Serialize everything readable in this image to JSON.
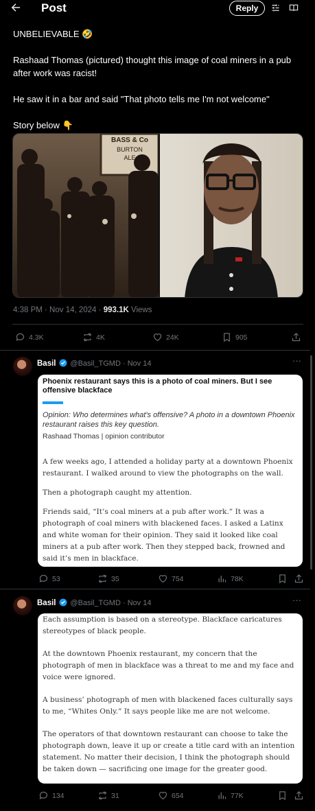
{
  "header": {
    "title": "Post",
    "reply_label": "Reply"
  },
  "main_tweet": {
    "text": "UNBELIEVABLE 🤣\n\nRashaad Thomas (pictured) thought this image of coal miners in a pub after work was racist!\n\nHe saw it in a bar and said \"That photo tells me I'm not welcome\"\n\nStory below 👇",
    "photo_sign_1": "BASS & Co",
    "photo_sign_2": "BURTON",
    "photo_sign_3": "ALE",
    "time": "4:38 PM · Nov 14, 2024 · ",
    "views_count": "993.1K",
    "views_label": " Views",
    "stats": {
      "replies": "4.3K",
      "reposts": "4K",
      "likes": "24K",
      "bookmarks": "905"
    }
  },
  "reply1": {
    "name": "Basil",
    "handle": "@Basil_TGMD · Nov 14",
    "headline": "Phoenix restaurant says this is a photo of coal miners. But I see offensive blackface",
    "subhead": "Opinion: Who determines what's offensive? A photo in a downtown Phoenix restaurant raises this key question.",
    "byline": "Rashaad Thomas  |  opinion contributor",
    "paragraphs": [
      "A few weeks ago, I attended a holiday party at a downtown Phoenix restaurant. I walked around to view the photographs on the wall.",
      "Then a photograph caught my attention.",
      "Friends said, “It’s coal miners at a pub after work.” It was a photograph of coal miners with blackened faces. I asked a Latinx and white woman for their opinion. They said it looked like coal miners at a pub after work. Then they stepped back, frowned and said it’s men in blackface."
    ],
    "stats": {
      "replies": "53",
      "reposts": "35",
      "likes": "754",
      "views": "78K"
    }
  },
  "reply2": {
    "name": "Basil",
    "handle": "@Basil_TGMD · Nov 14",
    "paragraphs": [
      "Each assumption is based on a stereotype. Blackface caricatures stereotypes of black people.",
      "At the downtown Phoenix restaurant, my concern that the photograph of men in blackface was a threat to me and my face and voice were ignored.",
      "A business’ photograph of men with blackened faces culturally says to me, “Whites Only.” It says people like me are not welcome.",
      "The operators of that downtown restaurant can choose to take the photograph down, leave it up or create a title card with an intention statement. No matter their decision, I think the photograph should be taken down — sacrificing one image for the greater good."
    ],
    "stats": {
      "replies": "134",
      "reposts": "31",
      "likes": "654",
      "views": "77K"
    }
  },
  "colors": {
    "accent": "#1d9bf0",
    "muted": "#71767b",
    "border": "#2f3336"
  }
}
